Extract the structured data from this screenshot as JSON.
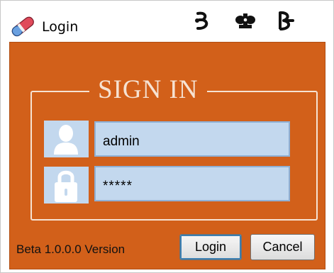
{
  "window": {
    "title": "Login",
    "icon": "eraser-icon"
  },
  "title_buttons": {
    "minimize_icon": "minimize-icon",
    "maximize_icon": "maximize-icon",
    "close_icon": "close-icon"
  },
  "form": {
    "heading": "SIGN IN",
    "username_value": "admin",
    "password_value": "*****",
    "username_icon": "user-icon",
    "password_icon": "lock-icon"
  },
  "footer": {
    "version_text": "Beta 1.0.0.0 Version",
    "login_label": "Login",
    "cancel_label": "Cancel"
  },
  "colors": {
    "panel": "#d2601a",
    "frame": "#f6e2d2",
    "field_background": "#c3d8ee"
  }
}
